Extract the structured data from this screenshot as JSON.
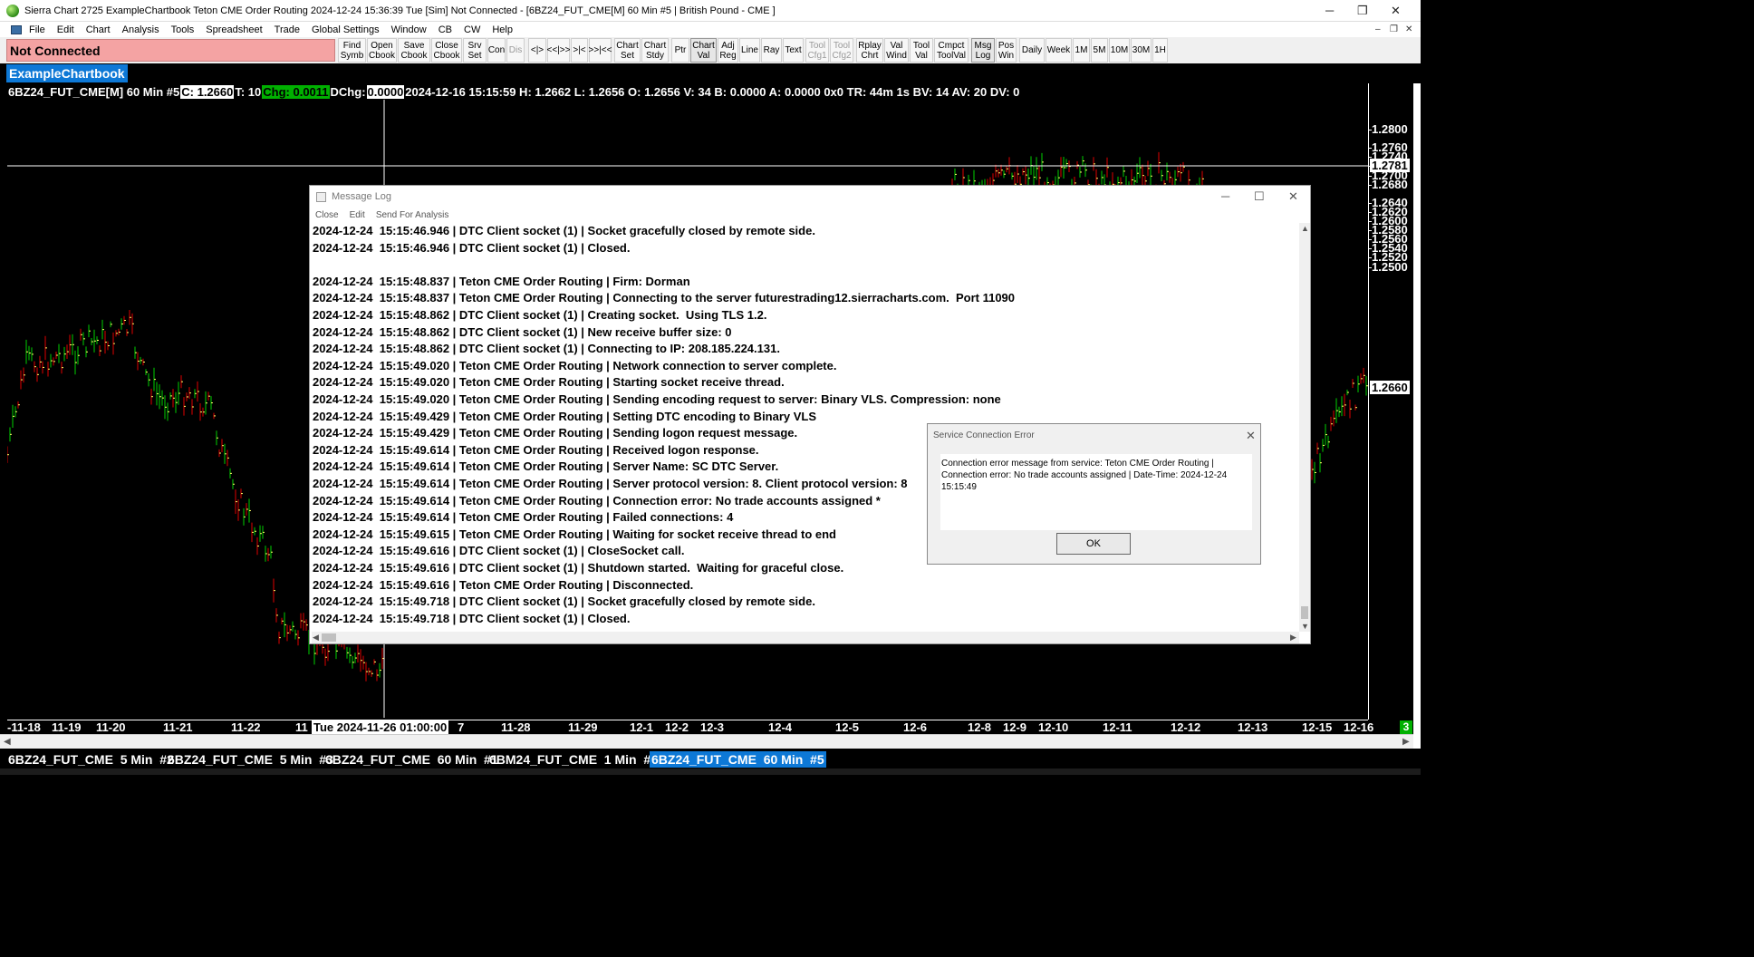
{
  "window": {
    "title": "Sierra Chart 2725 ExampleChartbook Teton CME Order Routing 2024-12-24  15:36:39 Tue [Sim] Not Connected - [6BZ24_FUT_CME[M]  60 Min  #5 | British Pound - CME ]",
    "minimize": "─",
    "restore": "❐",
    "close": "✕"
  },
  "menu": {
    "items": [
      "File",
      "Edit",
      "Chart",
      "Analysis",
      "Tools",
      "Spreadsheet",
      "Trade",
      "Global Settings",
      "Window",
      "CB",
      "CW",
      "Help"
    ],
    "mdi_minimize": "–",
    "mdi_restore": "❐",
    "mdi_close": "✕"
  },
  "toolbar": {
    "status": "Not Connected",
    "buttons": [
      "Find\nSymb",
      "Open\nCbook",
      "Save\nCbook",
      "Close\nCbook",
      "Srv\nSet",
      "Con",
      "Dis",
      "<|>",
      "<<|>>",
      ">|<",
      ">>|<<",
      "Chart\nSet",
      "Chart\nStdy",
      "Ptr",
      "Chart\nVal",
      "Adj\nReg",
      "Line",
      "Ray",
      "Text",
      "Tool\nCfg1",
      "Tool\nCfg2",
      "Rplay\nChrt",
      "Val\nWind",
      "Tool\nVal",
      "Cmpct\nToolVal",
      "Msg\nLog",
      "Pos\nWin",
      "Daily",
      "Week",
      "1M",
      "5M",
      "10M",
      "30M",
      "1H"
    ]
  },
  "chartbook": {
    "name": "ExampleChartbook"
  },
  "infobar": {
    "symbol": "6BZ24_FUT_CME[M]  60 Min  #5",
    "close": "C: 1.2660",
    "trades": "T: 10",
    "change": "Chg: 0.0011",
    "dchg_label": "DChg:",
    "dchg_value": "0.0000",
    "rest": "2024-12-16 15:15:59 H: 1.2662 L: 1.2656 O: 1.2656 V: 34 B: 0.0000 A: 0.0000 0x0 TR: 44m 1s BV: 14 AV: 20 DV: 0"
  },
  "chart_data": {
    "type": "candlestick",
    "y_axis_labels": [
      "1.2800",
      "1.2760",
      "1.2740",
      "1.2720",
      "1.2700",
      "1.2680",
      "1.2620",
      "1.2640",
      "1.2600",
      "1.2580",
      "1.2560",
      "1.2540",
      "1.2520",
      "1.2500"
    ],
    "y_values": [
      1.28,
      1.276,
      1.274,
      1.272,
      1.27,
      1.268,
      1.262,
      1.264,
      1.26,
      1.258,
      1.256,
      1.254,
      1.252,
      1.25
    ],
    "crosshair_price": "1.2781",
    "last_price": "1.2660",
    "x_axis_labels": [
      "-11-18",
      "11-19",
      "11-20",
      "11-21",
      "11-22",
      "11",
      "7",
      "11-28",
      "11-29",
      "12-1",
      "12-2",
      "12-3",
      "12-4",
      "12-5",
      "12-6",
      "12-8",
      "12-9",
      "12-10",
      "12-11",
      "12-12",
      "12-13",
      "12-15",
      "12-16"
    ],
    "crosshair_time": "Tue 2024-11-26  01:00:00",
    "bar_count": "3",
    "up_color": "#00d000",
    "down_color": "#e00000"
  },
  "message_log": {
    "title": "Message Log",
    "menu": [
      "Close",
      "Edit",
      "Send For Analysis"
    ],
    "lines": [
      "2024-12-24  15:15:46.946 | DTC Client socket (1) | Socket gracefully closed by remote side.",
      "2024-12-24  15:15:46.946 | DTC Client socket (1) | Closed.",
      "",
      "2024-12-24  15:15:48.837 | Teton CME Order Routing | Firm: Dorman",
      "2024-12-24  15:15:48.837 | Teton CME Order Routing | Connecting to the server futurestrading12.sierracharts.com.  Port 11090",
      "2024-12-24  15:15:48.862 | DTC Client socket (1) | Creating socket.  Using TLS 1.2.",
      "2024-12-24  15:15:48.862 | DTC Client socket (1) | New receive buffer size: 0",
      "2024-12-24  15:15:48.862 | DTC Client socket (1) | Connecting to IP: 208.185.224.131.",
      "2024-12-24  15:15:49.020 | Teton CME Order Routing | Network connection to server complete.",
      "2024-12-24  15:15:49.020 | Teton CME Order Routing | Starting socket receive thread.",
      "2024-12-24  15:15:49.020 | Teton CME Order Routing | Sending encoding request to server: Binary VLS. Compression: none",
      "2024-12-24  15:15:49.429 | Teton CME Order Routing | Setting DTC encoding to Binary VLS",
      "2024-12-24  15:15:49.429 | Teton CME Order Routing | Sending logon request message.",
      "2024-12-24  15:15:49.614 | Teton CME Order Routing | Received logon response.",
      "2024-12-24  15:15:49.614 | Teton CME Order Routing | Server Name: SC DTC Server.",
      "2024-12-24  15:15:49.614 | Teton CME Order Routing | Server protocol version: 8. Client protocol version: 8",
      "2024-12-24  15:15:49.614 | Teton CME Order Routing | Connection error: No trade accounts assigned *",
      "2024-12-24  15:15:49.614 | Teton CME Order Routing | Failed connections: 4",
      "2024-12-24  15:15:49.615 | Teton CME Order Routing | Waiting for socket receive thread to end",
      "2024-12-24  15:15:49.616 | DTC Client socket (1) | CloseSocket call.",
      "2024-12-24  15:15:49.616 | DTC Client socket (1) | Shutdown started.  Waiting for graceful close.",
      "2024-12-24  15:15:49.616 | Teton CME Order Routing | Disconnected.",
      "2024-12-24  15:15:49.718 | DTC Client socket (1) | Socket gracefully closed by remote side.",
      "2024-12-24  15:15:49.718 | DTC Client socket (1) | Closed."
    ]
  },
  "error_dialog": {
    "title": "Service Connection Error",
    "message": "Connection error message from service: Teton CME Order Routing | Connection error: No trade accounts assigned | Date-Time: 2024-12-24 15:15:49",
    "ok": "OK",
    "close": "✕"
  },
  "chart_tabs": [
    "6BZ24_FUT_CME  5 Min  #2",
    "6BZ24_FUT_CME  5 Min  #3",
    "6BZ24_FUT_CME  60 Min  #1",
    "6BM24_FUT_CME  1 Min  #4",
    "6BZ24_FUT_CME  60 Min  #5"
  ]
}
